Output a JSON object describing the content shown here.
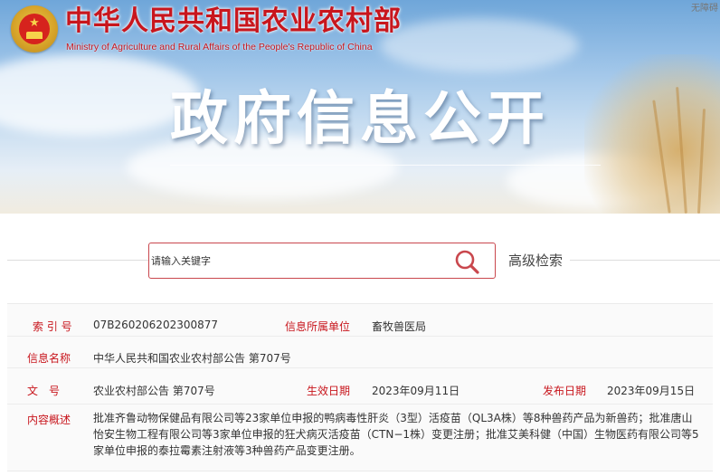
{
  "header": {
    "ministry_cn": "中华人民共和国农业农村部",
    "ministry_en": "Ministry of Agriculture and Rural Affairs of the People's Republic of China",
    "section_title": "政府信息公开",
    "corner_text": "无障碍",
    "emblem_icon": "national-emblem-icon"
  },
  "search": {
    "placeholder": "请输入关键字",
    "button_icon": "search-icon",
    "advanced_label": "高级检索",
    "accent_color": "#c9474d"
  },
  "info": {
    "index_label": "索 引 号",
    "index_value": "07B260206202300877",
    "dept_label": "信息所属单位",
    "dept_value": "畜牧兽医局",
    "name_label": "信息名称",
    "name_value": "中华人民共和国农业农村部公告 第707号",
    "docno_label": "文　号",
    "docno_value": "农业农村部公告 第707号",
    "effective_label": "生效日期",
    "effective_value": "2023年09月11日",
    "publish_label": "发布日期",
    "publish_value": "2023年09月15日",
    "summary_label": "内容概述",
    "summary_value": "批准齐鲁动物保健品有限公司等23家单位申报的鸭病毒性肝炎（3型）活疫苗（QL3A株）等8种兽药产品为新兽药；批准唐山怡安生物工程有限公司等3家单位申报的狂犬病灭活疫苗（CTN−1株）变更注册；批准艾美科健（中国）生物医药有限公司等5家单位申报的泰拉霉素注射液等3种兽药产品变更注册。",
    "label_color": "#c8161d"
  }
}
